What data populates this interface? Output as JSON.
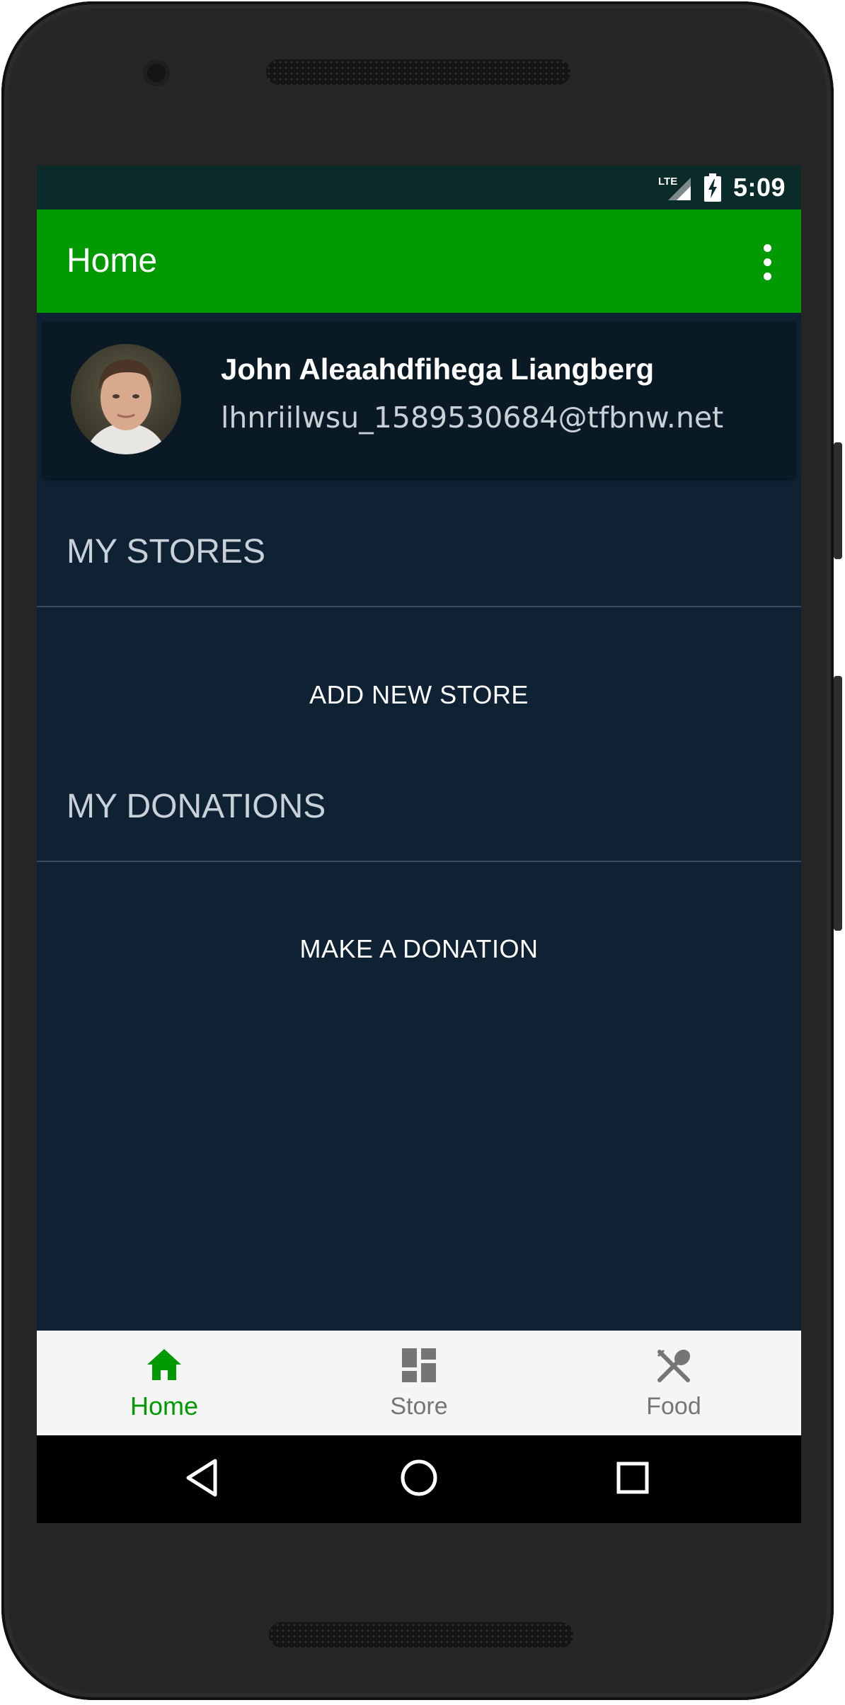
{
  "status_bar": {
    "network_label": "LTE",
    "time": "5:09",
    "icons": [
      "lte-signal-icon",
      "battery-charging-icon"
    ]
  },
  "app_bar": {
    "title": "Home",
    "menu_icon": "more-vertical-icon"
  },
  "profile": {
    "name": "John Aleaahdfihega Liangberg",
    "email": "lhnriilwsu_1589530684@tfbnw.net",
    "avatar": "avatar-photo"
  },
  "sections": {
    "stores": {
      "header": "MY STORES",
      "action_label": "ADD NEW STORE"
    },
    "donations": {
      "header": "MY DONATIONS",
      "action_label": "MAKE A DONATION"
    }
  },
  "bottom_nav": {
    "items": [
      {
        "label": "Home",
        "icon": "home-icon",
        "active": true
      },
      {
        "label": "Store",
        "icon": "dashboard-icon",
        "active": false
      },
      {
        "label": "Food",
        "icon": "utensils-icon",
        "active": false
      }
    ]
  },
  "system_nav": {
    "icons": [
      "back-icon",
      "home-circle-icon",
      "recents-icon"
    ]
  },
  "colors": {
    "app_bar": "#029a02",
    "status_bar": "#0b2b2a",
    "background": "#0e2233",
    "card": "#0a1a24",
    "nav_active": "#029a02",
    "nav_inactive": "#757575"
  }
}
